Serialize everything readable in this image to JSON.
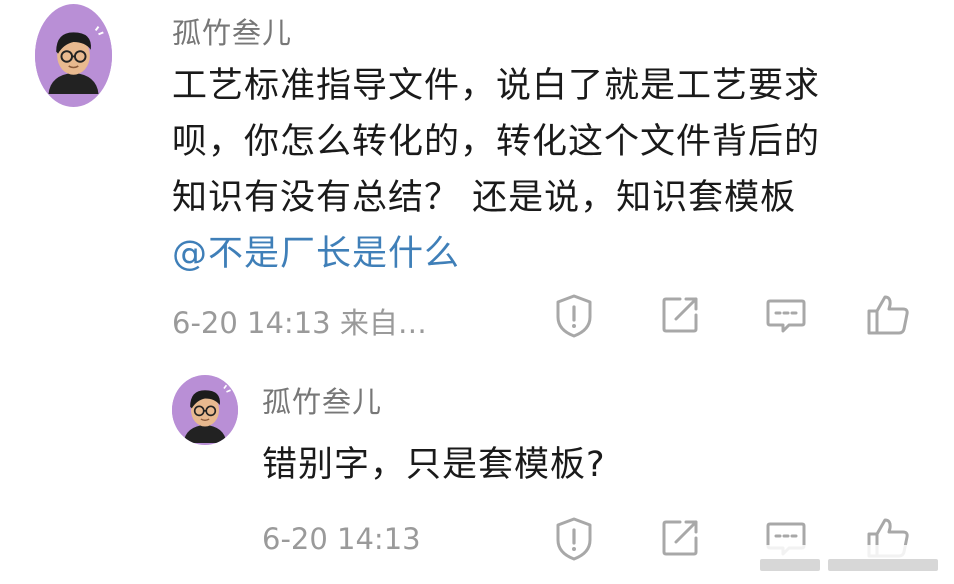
{
  "comment": {
    "username": "孤竹叁儿",
    "text_lines": [
      "工艺标准指导文件，说白了就是工艺要求",
      "呗，你怎么转化的，转化这个文件背后的",
      "知识有没有总结？ 还是说，知识套模板"
    ],
    "mention": "@不是厂长是什么",
    "meta": "6-20 14:13 来自…",
    "avatar_icon": "cartoon-avatar-icon",
    "actions": [
      "report-icon",
      "share-icon",
      "comment-icon",
      "like-icon"
    ]
  },
  "reply": {
    "username": "孤竹叁儿",
    "text": "错别字，只是套模板?",
    "meta": "6-20 14:13",
    "avatar_icon": "cartoon-avatar-icon",
    "actions": [
      "report-icon",
      "share-icon",
      "comment-icon",
      "like-icon"
    ]
  },
  "colors": {
    "avatar_bg": "#b98fd6",
    "mention": "#3f7fb8",
    "meta": "#9a9a9a",
    "username": "#777777",
    "icon": "#a8a8a8"
  }
}
